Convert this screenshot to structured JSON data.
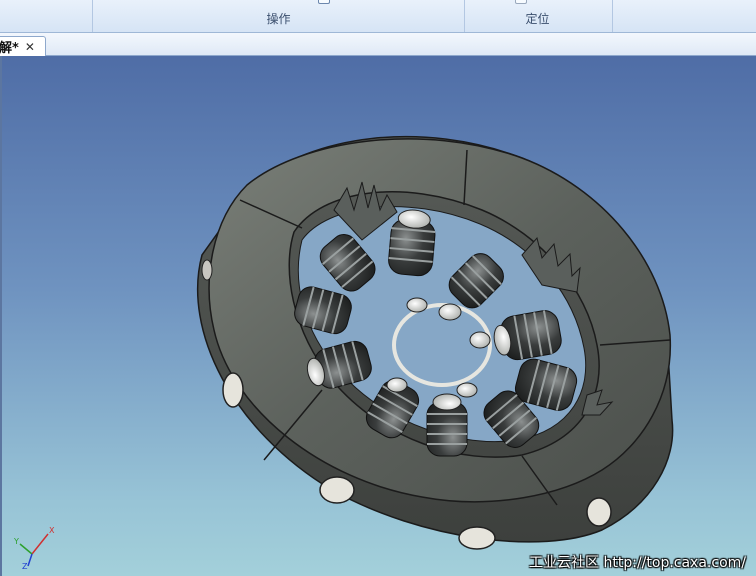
{
  "ribbon": {
    "groups": [
      {
        "label": "操作"
      },
      {
        "label": "定位"
      }
    ]
  },
  "document": {
    "tab_label": "解*",
    "close_glyph": "✕"
  },
  "viewport": {
    "model": "clutch-assembly-model",
    "background_top": "#4f6da6",
    "background_bottom": "#a3d0da",
    "triad": {
      "x_label": "X",
      "y_label": "Y",
      "z_label": "Z"
    },
    "watermark": "工业云社区 http://top.caxa.com/"
  }
}
